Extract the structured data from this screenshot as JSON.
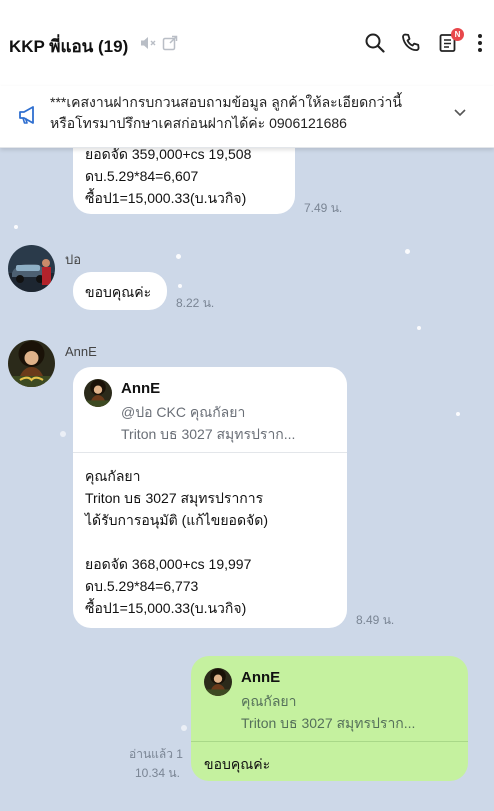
{
  "header": {
    "title": "KKP พี่แอน (19)",
    "notes_badge": "N"
  },
  "announcement": {
    "line1": "***เคสงานฝากรบกวนสอบถามข้อมูล ลูกค้าให้ละเอียดกว่านี้",
    "line2": "หรือโทรมาปรึกษาเคสก่อนฝากได้ค่ะ 0906121686"
  },
  "messages": {
    "m1": {
      "lines": [
        "ยอดจัด 359,000+cs 19,508",
        "ดบ.5.29*84=6,607",
        "ซื้อป1=15,000.33(บ.นวกิจ)"
      ],
      "time": "7.49 น."
    },
    "m2": {
      "sender": "ปอ",
      "text": "ขอบคุณค่ะ",
      "time": "8.22 น."
    },
    "m3": {
      "sender": "AnnE",
      "quote_name": "AnnE",
      "quote_line1": "@ปอ CKC คุณกัลยา",
      "quote_line2": "Triton บธ 3027  สมุทรปราก...",
      "lines": [
        "คุณกัลยา",
        "Triton บธ 3027  สมุทรปราการ",
        "ได้รับการอนุมัติ (แก้ไขยอดจัด)",
        "",
        "ยอดจัด 368,000+cs 19,997",
        "ดบ.5.29*84=6,773",
        "ซื้อป1=15,000.33(บ.นวกิจ)"
      ],
      "time": "8.49 น."
    },
    "m4": {
      "quote_name": "AnnE",
      "quote_line1": "คุณกัลยา",
      "quote_line2": "Triton บธ 3027  สมุทรปราก...",
      "text": "ขอบคุณค่ะ",
      "read": "อ่านแล้ว 1",
      "time": "10.34 น."
    }
  },
  "colors": {
    "chat_bg": "#cdd8e8",
    "own_bubble": "#c5f19f",
    "badge": "#e8474b",
    "announce_icon": "#2f6fd0"
  }
}
